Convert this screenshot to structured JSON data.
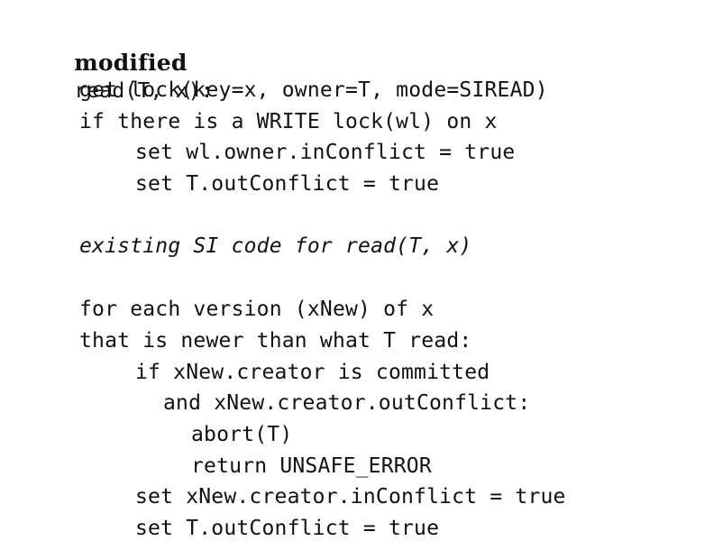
{
  "heading": {
    "keyword": "modified",
    "signature": "read(T, x):"
  },
  "lines": [
    "get lock(key=x, owner=T, mode=SIREAD)",
    "if there is a WRITE lock(wl) on x",
    "set wl.owner.inConflict = true",
    "set T.outConflict = true",
    "existing SI code for read(T, x)",
    "for each version (xNew) of x",
    "that is newer than what T read:",
    "if xNew.creator is committed",
    "and xNew.creator.outConflict:",
    "abort(T)",
    "return UNSAFE_ERROR",
    "set xNew.creator.inConflict = true",
    "set T.outConflict = true"
  ]
}
